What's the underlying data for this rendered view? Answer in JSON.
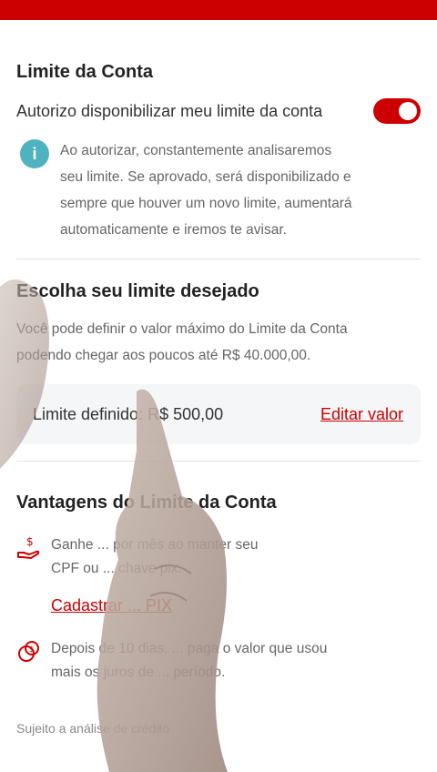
{
  "colors": {
    "accent": "#cc0000",
    "info": "#4fb3bf",
    "panel": "#f4f6f8"
  },
  "account_limit": {
    "title": "Limite da Conta",
    "toggle_label": "Autorizo disponibilizar meu limite da conta",
    "toggle_on": true,
    "info_icon": "info-icon",
    "info_lines": [
      "Ao autorizar, constantemente analisaremos",
      "seu limite. Se aprovado, será disponibilizado e",
      "sempre que houver um novo limite, aumentará",
      "automaticamente e iremos te avisar."
    ]
  },
  "desired_limit": {
    "title": "Escolha seu limite desejado",
    "desc_lines": [
      "Você pode definir o valor máximo do Limite da Conta",
      "podendo chegar aos poucos até R$ 40.000,00."
    ],
    "defined_label": "Limite definido: R$ 500,00",
    "edit_link": "Editar valor"
  },
  "advantages": {
    "title": "Vantagens do Limite da Conta",
    "item1_icon": "hand-money-icon",
    "item1_lines": [
      "Ganhe ... por mês ao manter seu",
      "CPF ou ... chave pix."
    ],
    "register_link": "Cadastrar ... PIX",
    "item2_icon": "coins-icon",
    "item2_lines": [
      "Depois de 10 dias, ... paga o valor que usou",
      "mais os juros de ... período."
    ]
  },
  "footer": {
    "text": "Sujeito a análise de crédito"
  }
}
